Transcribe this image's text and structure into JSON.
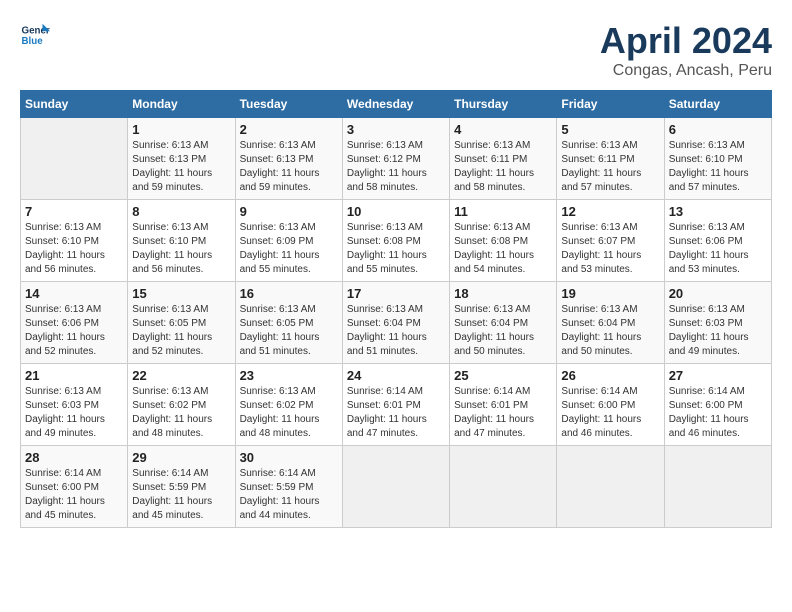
{
  "header": {
    "logo_line1": "General",
    "logo_line2": "Blue",
    "title": "April 2024",
    "subtitle": "Congas, Ancash, Peru"
  },
  "days_of_week": [
    "Sunday",
    "Monday",
    "Tuesday",
    "Wednesday",
    "Thursday",
    "Friday",
    "Saturday"
  ],
  "weeks": [
    [
      {
        "num": "",
        "empty": true
      },
      {
        "num": "1",
        "sunrise": "6:13 AM",
        "sunset": "6:13 PM",
        "daylight": "11 hours and 59 minutes."
      },
      {
        "num": "2",
        "sunrise": "6:13 AM",
        "sunset": "6:13 PM",
        "daylight": "11 hours and 59 minutes."
      },
      {
        "num": "3",
        "sunrise": "6:13 AM",
        "sunset": "6:12 PM",
        "daylight": "11 hours and 58 minutes."
      },
      {
        "num": "4",
        "sunrise": "6:13 AM",
        "sunset": "6:11 PM",
        "daylight": "11 hours and 58 minutes."
      },
      {
        "num": "5",
        "sunrise": "6:13 AM",
        "sunset": "6:11 PM",
        "daylight": "11 hours and 57 minutes."
      },
      {
        "num": "6",
        "sunrise": "6:13 AM",
        "sunset": "6:10 PM",
        "daylight": "11 hours and 57 minutes."
      }
    ],
    [
      {
        "num": "7",
        "sunrise": "6:13 AM",
        "sunset": "6:10 PM",
        "daylight": "11 hours and 56 minutes."
      },
      {
        "num": "8",
        "sunrise": "6:13 AM",
        "sunset": "6:10 PM",
        "daylight": "11 hours and 56 minutes."
      },
      {
        "num": "9",
        "sunrise": "6:13 AM",
        "sunset": "6:09 PM",
        "daylight": "11 hours and 55 minutes."
      },
      {
        "num": "10",
        "sunrise": "6:13 AM",
        "sunset": "6:08 PM",
        "daylight": "11 hours and 55 minutes."
      },
      {
        "num": "11",
        "sunrise": "6:13 AM",
        "sunset": "6:08 PM",
        "daylight": "11 hours and 54 minutes."
      },
      {
        "num": "12",
        "sunrise": "6:13 AM",
        "sunset": "6:07 PM",
        "daylight": "11 hours and 53 minutes."
      },
      {
        "num": "13",
        "sunrise": "6:13 AM",
        "sunset": "6:06 PM",
        "daylight": "11 hours and 53 minutes."
      }
    ],
    [
      {
        "num": "14",
        "sunrise": "6:13 AM",
        "sunset": "6:06 PM",
        "daylight": "11 hours and 52 minutes."
      },
      {
        "num": "15",
        "sunrise": "6:13 AM",
        "sunset": "6:05 PM",
        "daylight": "11 hours and 52 minutes."
      },
      {
        "num": "16",
        "sunrise": "6:13 AM",
        "sunset": "6:05 PM",
        "daylight": "11 hours and 51 minutes."
      },
      {
        "num": "17",
        "sunrise": "6:13 AM",
        "sunset": "6:04 PM",
        "daylight": "11 hours and 51 minutes."
      },
      {
        "num": "18",
        "sunrise": "6:13 AM",
        "sunset": "6:04 PM",
        "daylight": "11 hours and 50 minutes."
      },
      {
        "num": "19",
        "sunrise": "6:13 AM",
        "sunset": "6:04 PM",
        "daylight": "11 hours and 50 minutes."
      },
      {
        "num": "20",
        "sunrise": "6:13 AM",
        "sunset": "6:03 PM",
        "daylight": "11 hours and 49 minutes."
      }
    ],
    [
      {
        "num": "21",
        "sunrise": "6:13 AM",
        "sunset": "6:03 PM",
        "daylight": "11 hours and 49 minutes."
      },
      {
        "num": "22",
        "sunrise": "6:13 AM",
        "sunset": "6:02 PM",
        "daylight": "11 hours and 48 minutes."
      },
      {
        "num": "23",
        "sunrise": "6:13 AM",
        "sunset": "6:02 PM",
        "daylight": "11 hours and 48 minutes."
      },
      {
        "num": "24",
        "sunrise": "6:14 AM",
        "sunset": "6:01 PM",
        "daylight": "11 hours and 47 minutes."
      },
      {
        "num": "25",
        "sunrise": "6:14 AM",
        "sunset": "6:01 PM",
        "daylight": "11 hours and 47 minutes."
      },
      {
        "num": "26",
        "sunrise": "6:14 AM",
        "sunset": "6:00 PM",
        "daylight": "11 hours and 46 minutes."
      },
      {
        "num": "27",
        "sunrise": "6:14 AM",
        "sunset": "6:00 PM",
        "daylight": "11 hours and 46 minutes."
      }
    ],
    [
      {
        "num": "28",
        "sunrise": "6:14 AM",
        "sunset": "6:00 PM",
        "daylight": "11 hours and 45 minutes."
      },
      {
        "num": "29",
        "sunrise": "6:14 AM",
        "sunset": "5:59 PM",
        "daylight": "11 hours and 45 minutes."
      },
      {
        "num": "30",
        "sunrise": "6:14 AM",
        "sunset": "5:59 PM",
        "daylight": "11 hours and 44 minutes."
      },
      {
        "num": "",
        "empty": true
      },
      {
        "num": "",
        "empty": true
      },
      {
        "num": "",
        "empty": true
      },
      {
        "num": "",
        "empty": true
      }
    ]
  ]
}
